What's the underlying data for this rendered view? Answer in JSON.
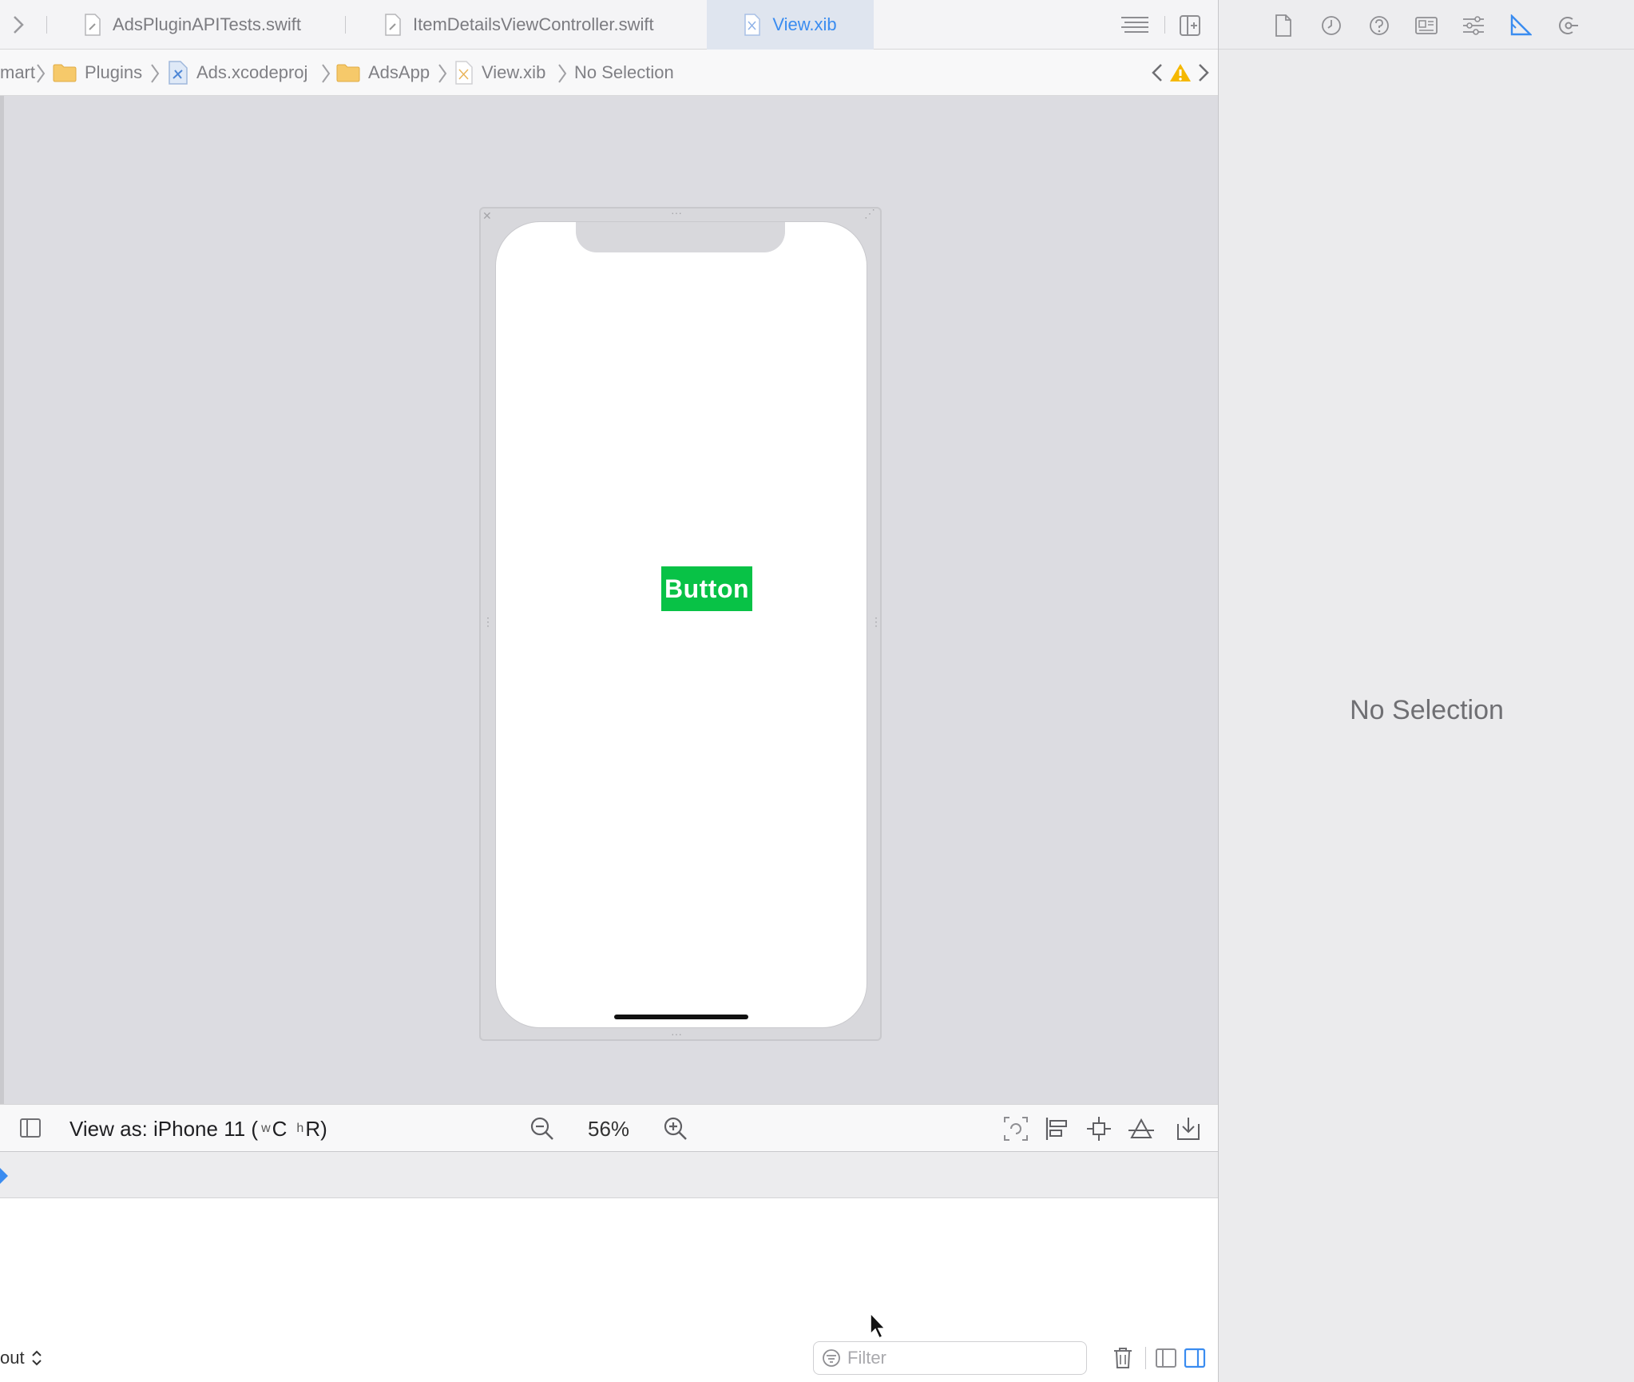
{
  "tabs": [
    {
      "label": "AdsPluginAPITests.swift",
      "active": false
    },
    {
      "label": "ItemDetailsViewController.swift",
      "active": false
    },
    {
      "label": "View.xib",
      "active": true
    }
  ],
  "breadcrumb": [
    "mart",
    "Plugins",
    "Ads.xcodeproj",
    "AdsApp",
    "View.xib",
    "No Selection"
  ],
  "canvas": {
    "button_label": "Button",
    "button_color": "#08c246"
  },
  "editor_bar": {
    "view_as_prefix": "View as: iPhone 11 (",
    "size_w": "w",
    "size_w_val": "C",
    "size_h": "h",
    "size_h_val": "R",
    "view_as_suffix": ")",
    "zoom": "56%"
  },
  "debug": {
    "layout_label": "out",
    "filter_placeholder": "Filter"
  },
  "inspector": {
    "empty_label": "No Selection"
  },
  "colors": {
    "accent": "#3a8cf0",
    "warning": "#f5b800"
  }
}
